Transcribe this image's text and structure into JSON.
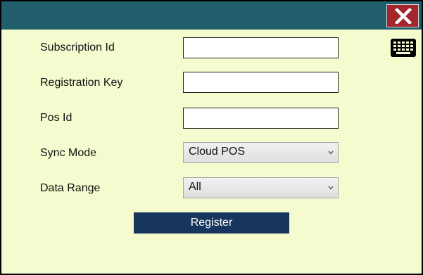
{
  "window": {
    "close_icon": "close-icon",
    "keyboard_icon": "keyboard-icon"
  },
  "form": {
    "subscription_id": {
      "label": "Subscription Id",
      "value": ""
    },
    "registration_key": {
      "label": "Registration Key",
      "value": ""
    },
    "pos_id": {
      "label": "Pos Id",
      "value": ""
    },
    "sync_mode": {
      "label": "Sync Mode",
      "selected": "Cloud POS"
    },
    "data_range": {
      "label": "Data Range",
      "selected": "All"
    }
  },
  "actions": {
    "register_label": "Register"
  },
  "colors": {
    "titlebar": "#215e6c",
    "background": "#f5fbcf",
    "close_button": "#a4262c",
    "register_button": "#17365d"
  }
}
